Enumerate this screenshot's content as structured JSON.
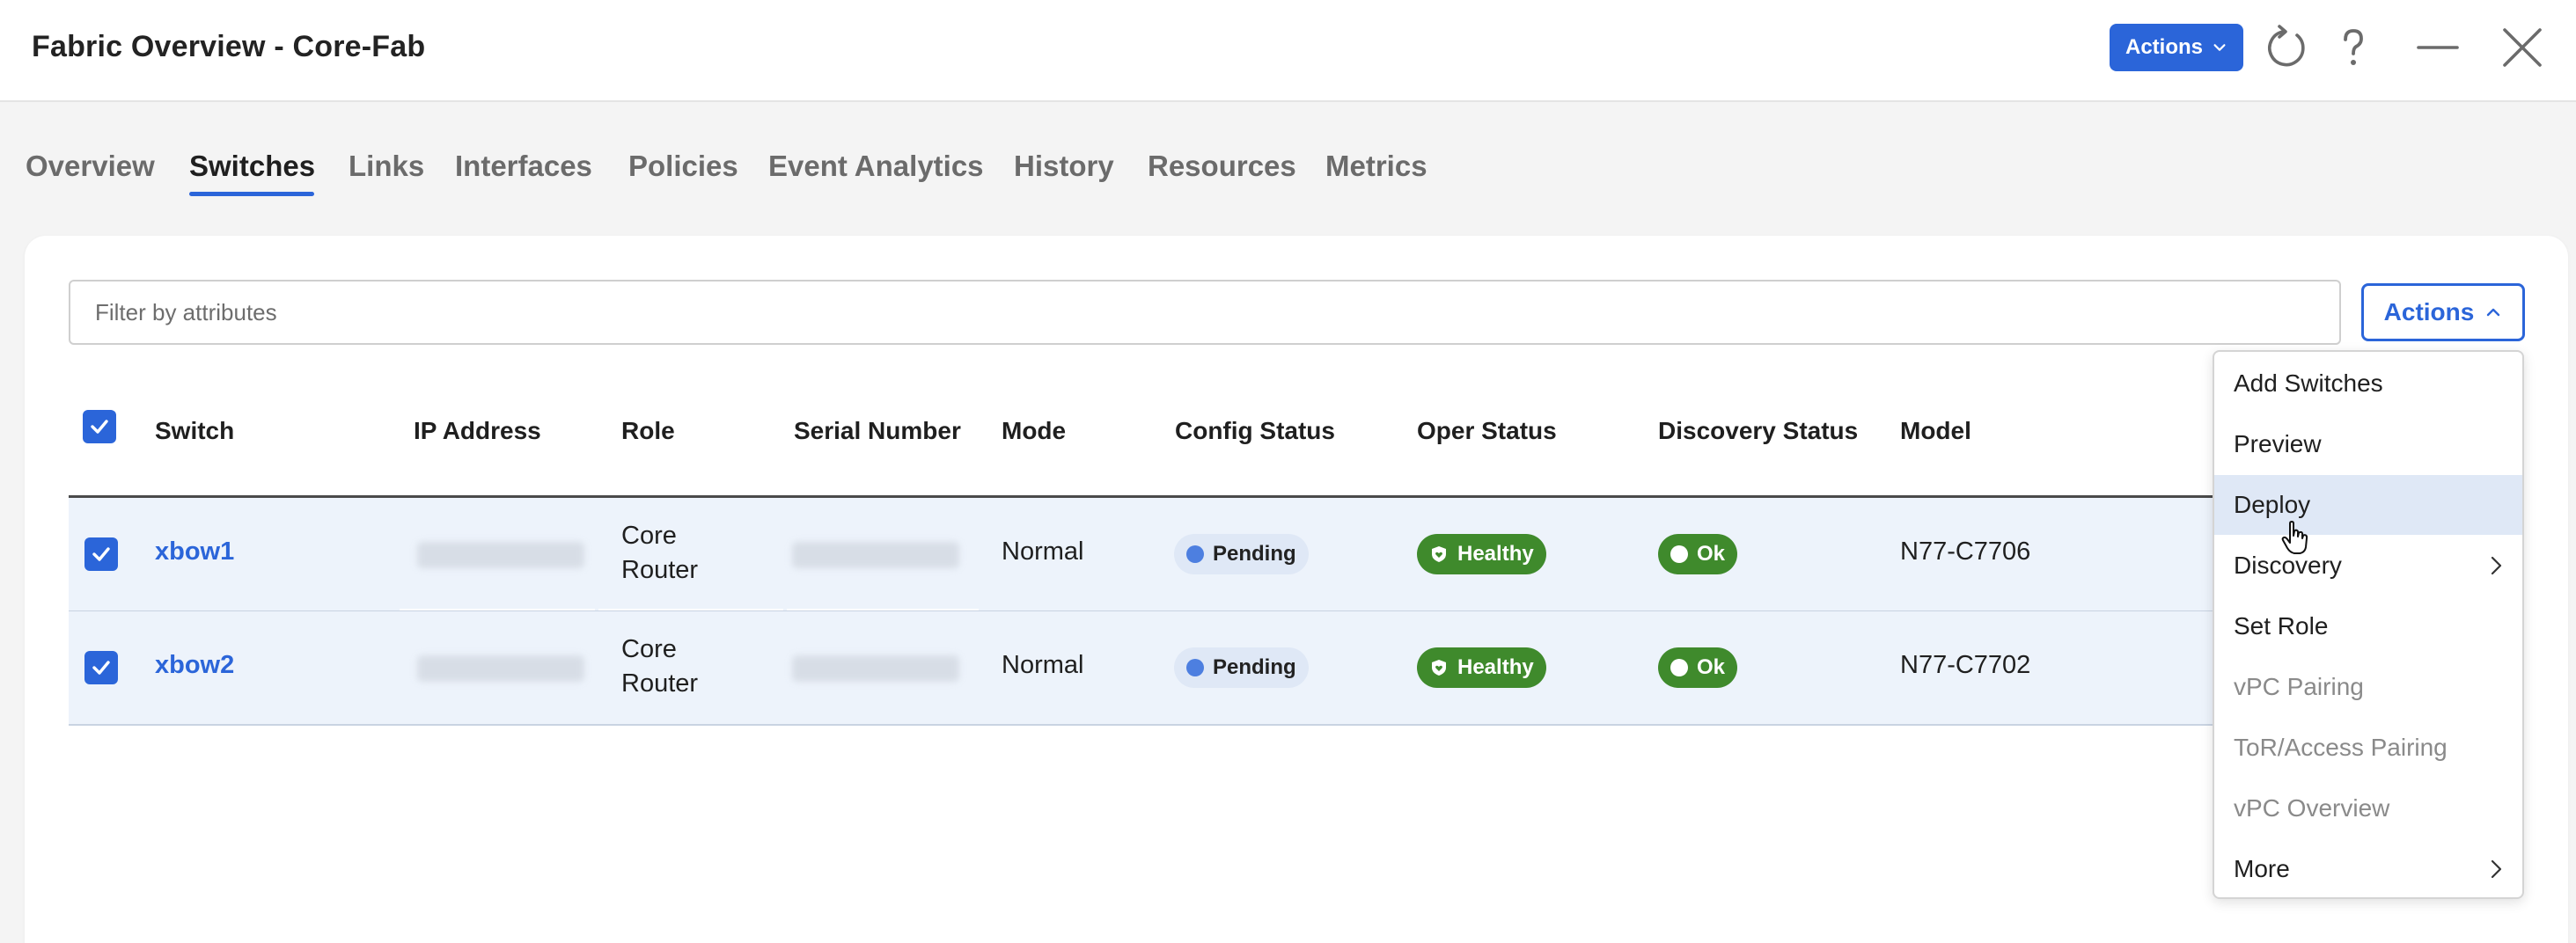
{
  "header": {
    "title": "Fabric Overview - Core-Fab",
    "actions_label": "Actions",
    "icons": [
      "refresh-icon",
      "help-icon",
      "minimize-icon",
      "close-icon"
    ]
  },
  "tabs": [
    {
      "label": "Overview",
      "active": false
    },
    {
      "label": "Switches",
      "active": true
    },
    {
      "label": "Links",
      "active": false
    },
    {
      "label": "Interfaces",
      "active": false
    },
    {
      "label": "Policies",
      "active": false
    },
    {
      "label": "Event Analytics",
      "active": false
    },
    {
      "label": "History",
      "active": false
    },
    {
      "label": "Resources",
      "active": false
    },
    {
      "label": "Metrics",
      "active": false
    }
  ],
  "toolbar": {
    "filter_placeholder": "Filter by attributes",
    "actions_label": "Actions"
  },
  "table": {
    "columns": [
      "Switch",
      "IP Address",
      "Role",
      "Serial Number",
      "Mode",
      "Config Status",
      "Oper Status",
      "Discovery Status",
      "Model"
    ],
    "rows": [
      {
        "switch": "xbow1",
        "role": "Core Router",
        "mode": "Normal",
        "config_status": "Pending",
        "oper_status": "Healthy",
        "discovery_status": "Ok",
        "model": "N77-C7706",
        "checked": true
      },
      {
        "switch": "xbow2",
        "role": "Core Router",
        "mode": "Normal",
        "config_status": "Pending",
        "oper_status": "Healthy",
        "discovery_status": "Ok",
        "model": "N77-C7702",
        "checked": true
      }
    ]
  },
  "menu": {
    "items": [
      {
        "label": "Add Switches",
        "enabled": true
      },
      {
        "label": "Preview",
        "enabled": true
      },
      {
        "label": "Deploy",
        "enabled": true,
        "hovered": true
      },
      {
        "label": "Discovery",
        "enabled": true,
        "submenu": true
      },
      {
        "label": "Set Role",
        "enabled": true
      },
      {
        "label": "vPC Pairing",
        "enabled": false
      },
      {
        "label": "ToR/Access Pairing",
        "enabled": false
      },
      {
        "label": "vPC Overview",
        "enabled": false
      },
      {
        "label": "More",
        "enabled": true,
        "submenu": true
      }
    ]
  },
  "colors": {
    "accent": "#2b65d9",
    "healthy": "#3f8a2c",
    "pending_bg": "#dfe8f6",
    "row_selected": "#edf3fb"
  }
}
